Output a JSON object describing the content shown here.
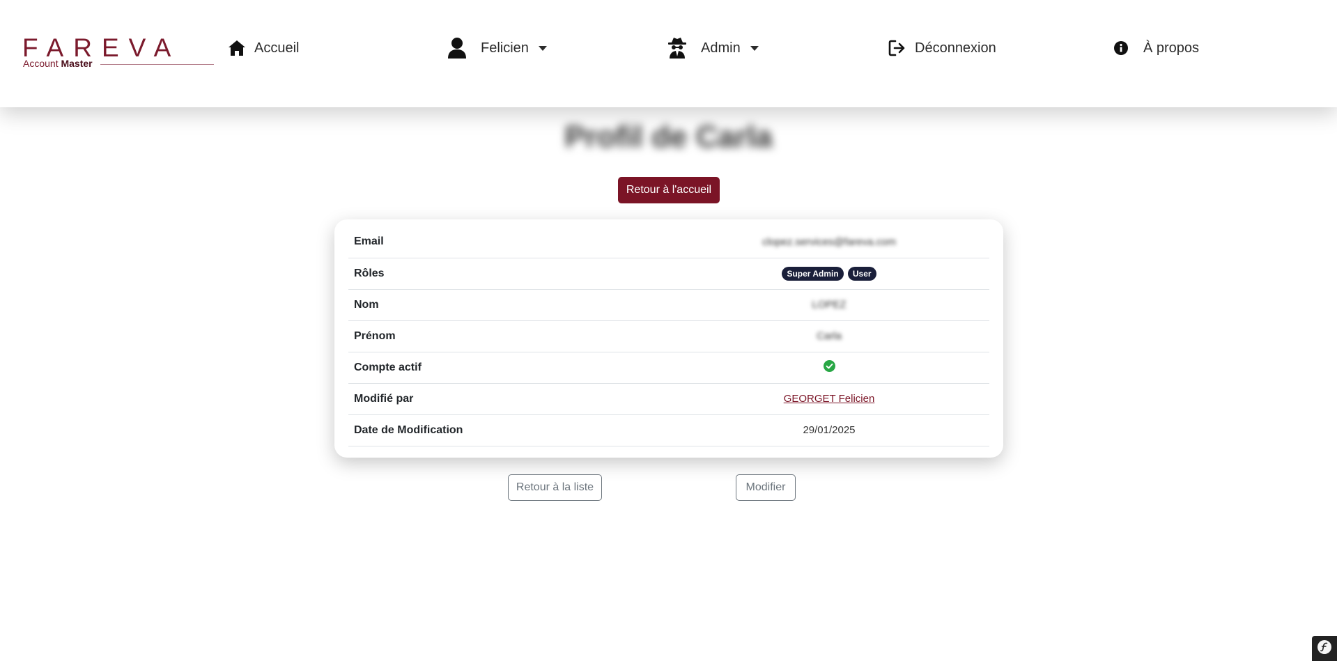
{
  "brand": {
    "wordmark": "FAREVA",
    "sub_prefix": "Account",
    "sub_bold": "Master"
  },
  "nav": {
    "home": "Accueil",
    "user": "Felicien",
    "admin": "Admin",
    "logout": "Déconnexion",
    "about": "À propos"
  },
  "page": {
    "title": "Profil de Carla",
    "home_button": "Retour à l'accueil"
  },
  "profile": {
    "email_label": "Email",
    "email_value": "clopez.services@fareva.com",
    "roles_label": "Rôles",
    "roles": [
      "Super Admin",
      "User"
    ],
    "lastname_label": "Nom",
    "lastname_value": "LOPEZ",
    "firstname_label": "Prénom",
    "firstname_value": "Carla",
    "active_label": "Compte actif",
    "active_value": true,
    "modified_by_label": "Modifié par",
    "modified_by_value": "GEORGET Felicien",
    "modified_date_label": "Date de Modification",
    "modified_date_value": "29/01/2025"
  },
  "actions": {
    "back_to_list": "Retour à la liste",
    "edit": "Modifier"
  },
  "colors": {
    "brand": "#7b1426",
    "badge": "#1a1f3a",
    "success": "#28a745"
  },
  "icons": {
    "home": "home-icon",
    "user": "user-icon",
    "admin": "spy-icon",
    "logout": "logout-icon",
    "about": "info-icon",
    "active": "check-circle-icon",
    "toolbar": "symfony-icon"
  }
}
